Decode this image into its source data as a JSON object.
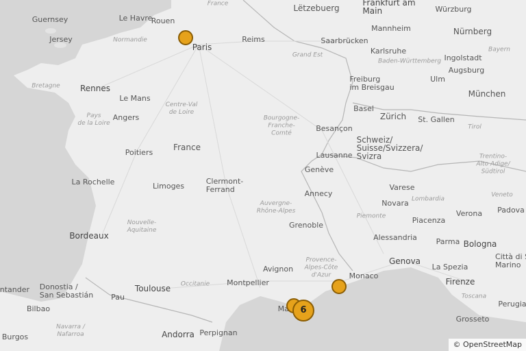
{
  "attribution": "© OpenStreetMap",
  "colors": {
    "water": "#d4d4d4",
    "land": "#eeeeee",
    "marker_fill": "#e6a21b",
    "marker_border": "#8a5d05",
    "border": "#b8b8b8"
  },
  "labels": {
    "guernsey": "Guernsey",
    "jersey": "Jersey",
    "le_havre": "Le Havre",
    "rouen": "Rouen",
    "france_top": "France",
    "normandie": "Normandie",
    "paris": "Paris",
    "reims": "Reims",
    "letzebuerg": "Lëtzebuerg",
    "frankfurt": "Frankfurt am\nMain",
    "wurzburg": "Würzburg",
    "mannheim": "Mannheim",
    "saarbrucken": "Saarbrücken",
    "nurnberg": "Nürnberg",
    "bayern": "Bayern",
    "karlsruhe": "Karlsruhe",
    "grand_est": "Grand Est",
    "ingolstadt": "Ingolstadt",
    "baden": "Baden-Württemberg",
    "augsburg": "Augsburg",
    "ulm": "Ulm",
    "munchen": "München",
    "freiburg": "Freiburg\nim Breisgau",
    "bretagne": "Bretagne",
    "rennes": "Rennes",
    "le_mans": "Le Mans",
    "centre": "Centre-Val\nde Loire",
    "pays_loire": "Pays\nde la Loire",
    "angers": "Angers",
    "bourgogne": "Bourgogne-\nFranche-\nComté",
    "basel": "Basel",
    "zurich": "Zürich",
    "st_gallen": "St. Gallen",
    "tirol": "Tirol",
    "besancon": "Besançon",
    "schweiz": "Schweiz/\nSuisse/Svizzera/\nSvizra",
    "france_mid": "France",
    "poitiers": "Poitiers",
    "lausanne": "Lausanne",
    "trentino": "Trentino-\nAlto Adige/\nSüdtirol",
    "geneve": "Genève",
    "la_rochelle": "La Rochelle",
    "limoges": "Limoges",
    "clermont": "Clermont-\nFerrand",
    "annecy": "Annecy",
    "varese": "Varese",
    "veneto": "Veneto",
    "novara": "Novara",
    "lombardia": "Lombardia",
    "auvergne": "Auvergne-\nRhône-Alpes",
    "verona": "Verona",
    "padova": "Padova",
    "piemonte": "Piemonte",
    "piacenza": "Piacenza",
    "nouvelle": "Nouvelle-\nAquitaine",
    "grenoble": "Grenoble",
    "bordeaux": "Bordeaux",
    "alessandria": "Alessandria",
    "parma": "Parma",
    "bologna": "Bologna",
    "genova": "Genova",
    "citta": "Città di S\nMarino",
    "avignon": "Avignon",
    "provence": "Provence-\nAlpes-Côte\nd'Azur",
    "la_spezia": "La Spezia",
    "monaco": "Monaco",
    "firenze": "Firenze",
    "toulouse": "Toulouse",
    "occitanie": "Occitanie",
    "montpellier": "Montpellier",
    "cantander": "antander",
    "donostia": "Donostia /\nSan Sebastián",
    "pau": "Pau",
    "toscana": "Toscana",
    "perugia": "Perugia",
    "bilbao": "Bilbao",
    "marseille": "Mar",
    "navarra": "Navarra /\nNafarroa",
    "grosseto": "Grosseto",
    "andorra": "Andorra",
    "perpignan": "Perpignan",
    "burgos": "Burgos"
  },
  "markers": [
    {
      "name": "marker-paris",
      "lat": 48.96,
      "lon": 2.05,
      "label": ""
    },
    {
      "name": "marker-nice",
      "lat": 43.7,
      "lon": 7.26,
      "label": ""
    },
    {
      "name": "marker-marseille",
      "lat": 43.3,
      "lon": 5.72,
      "label": ""
    },
    {
      "name": "marker-cluster-toulon",
      "lat": 43.2,
      "lon": 6.05,
      "label": "6",
      "cluster": true
    }
  ]
}
